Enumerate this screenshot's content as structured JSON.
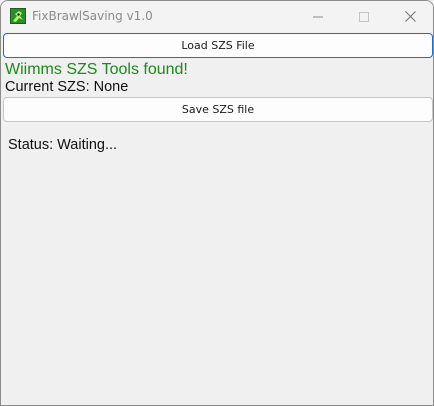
{
  "window": {
    "title": "FixBrawlSaving v1.0",
    "app_icon": "green-fighter-icon",
    "controls": [
      "minimize-icon",
      "maximize-icon",
      "close-icon"
    ]
  },
  "main": {
    "load_button": "Load SZS File",
    "tools_status": "Wiimms SZS Tools found!",
    "current_szs": "Current SZS: None",
    "save_button": "Save SZS file",
    "status": "Status: Waiting..."
  },
  "colors": {
    "success_text": "#1c8a1c",
    "focus_border": "#1f6fc0"
  }
}
